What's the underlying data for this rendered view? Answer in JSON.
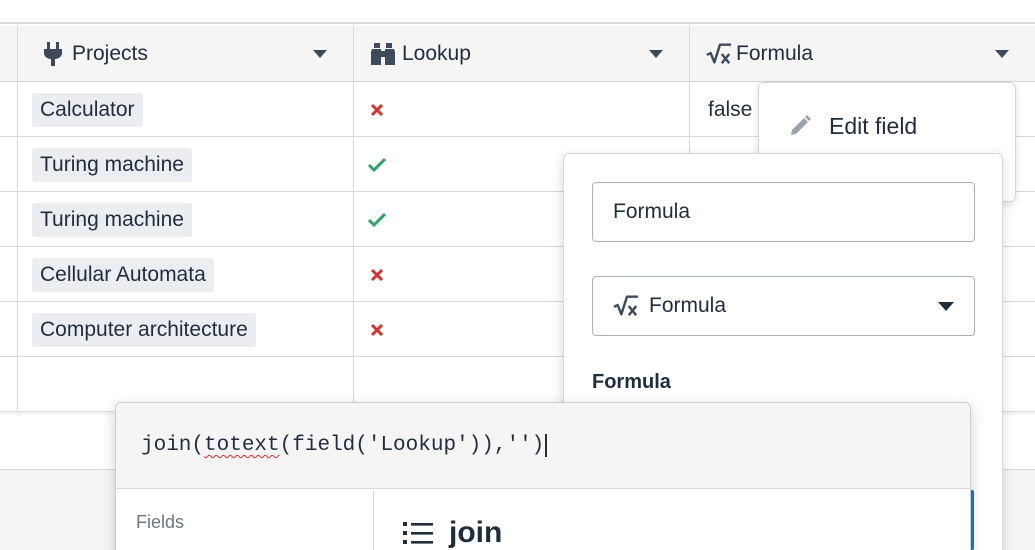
{
  "grid": {
    "columns": [
      {
        "label": "Projects",
        "icon": "plug-icon"
      },
      {
        "label": "Lookup",
        "icon": "binoculars-icon"
      },
      {
        "label": "Formula",
        "icon": "formula-icon"
      }
    ],
    "rows": [
      {
        "project": "Calculator",
        "lookup": "cross",
        "formula": "false"
      },
      {
        "project": "Turing machine",
        "lookup": "check",
        "formula": ""
      },
      {
        "project": "Turing machine",
        "lookup": "check",
        "formula": ""
      },
      {
        "project": "Cellular Automata",
        "lookup": "cross",
        "formula": ""
      },
      {
        "project": "Computer architecture",
        "lookup": "cross",
        "formula": ""
      }
    ],
    "colors": {
      "check": "#2ea36b",
      "cross": "#d2332c"
    }
  },
  "context_menu": {
    "edit_field_label": "Edit field"
  },
  "field_panel": {
    "name_value": "Formula",
    "type_label": "Formula",
    "formula_heading": "Formula"
  },
  "formula_editor": {
    "code_prefix": "join(",
    "code_misspelled": "totext",
    "code_suffix": "(field('Lookup')),'')",
    "fields_label": "Fields",
    "doc_function": "join",
    "accent": "#1877d6"
  }
}
